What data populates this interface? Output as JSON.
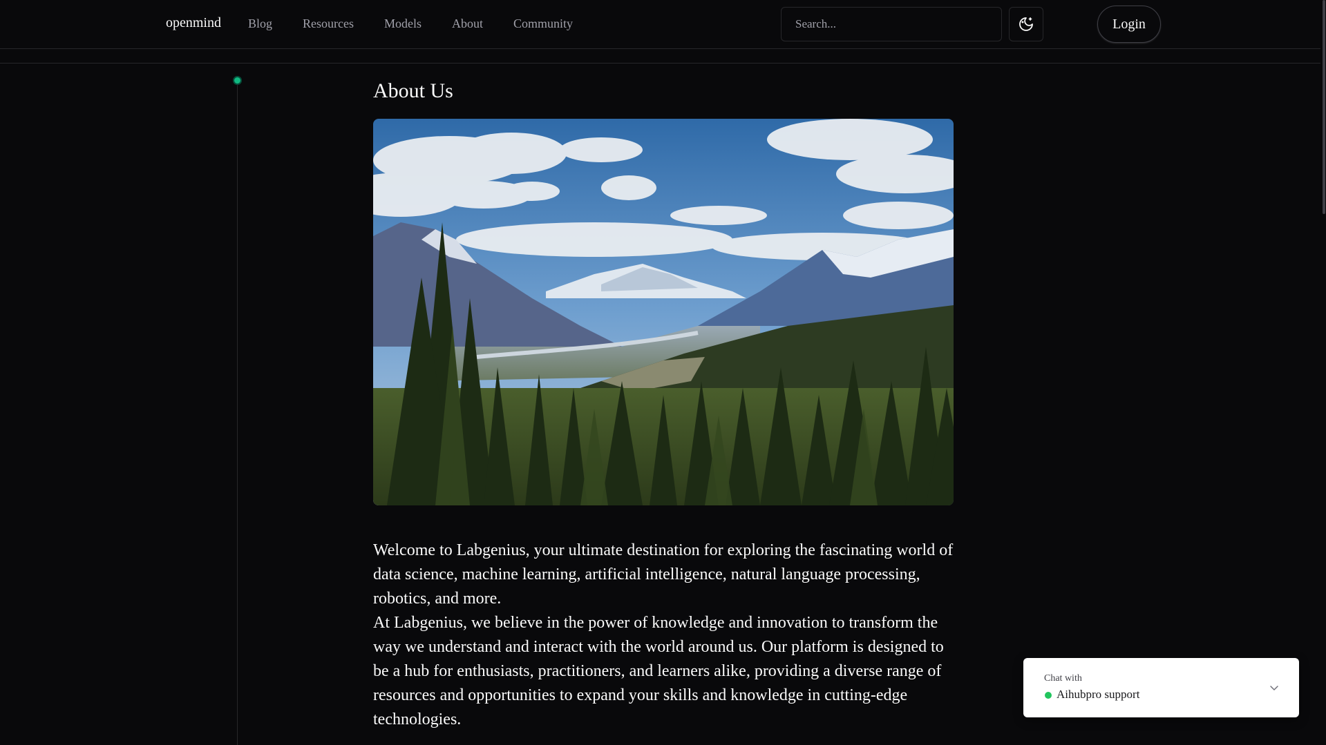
{
  "header": {
    "brand": "openmind",
    "nav": [
      "Blog",
      "Resources",
      "Models",
      "About",
      "Community"
    ],
    "search": {
      "placeholder": "Search..."
    },
    "theme_toggle_icon": "moon-sparkle-icon",
    "login_label": "Login"
  },
  "timeline": {
    "dot_color": "#10b981"
  },
  "main": {
    "title": "About Us",
    "hero_image": "mountain-forest-landscape",
    "paragraphs": [
      "Welcome to Labgenius, your ultimate destination for exploring the fascinating world of data science, machine learning, artificial intelligence, natural language processing, robotics, and more.",
      "At Labgenius, we believe in the power of knowledge and innovation to transform the way we understand and interact with the world around us. Our platform is designed to be a hub for enthusiasts, practitioners, and learners alike, providing a diverse range of resources and opportunities to expand your skills and knowledge in cutting-edge technologies."
    ]
  },
  "chat": {
    "label": "Chat with",
    "name": "Aihubpro support",
    "status_color": "#22c55e",
    "chevron_icon": "chevron-down-icon"
  },
  "colors": {
    "background": "#09090b",
    "border": "#27272a",
    "text": "#fafafa",
    "muted": "#a1a1aa"
  }
}
